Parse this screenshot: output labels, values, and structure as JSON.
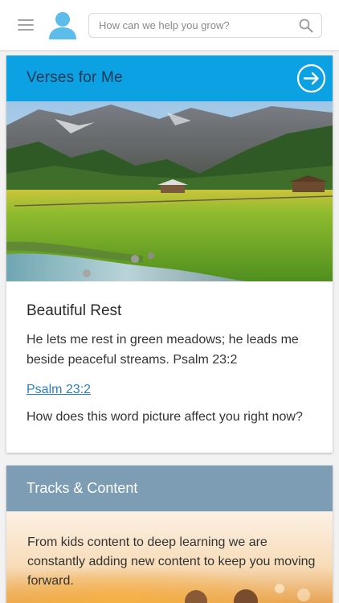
{
  "header": {
    "search_placeholder": "How can we help you grow?",
    "icons": [
      "menu-icon",
      "avatar-icon",
      "search-icon"
    ]
  },
  "verses_card": {
    "title": "Verses for Me",
    "header_color": "#0ba1e2",
    "verse_title": "Beautiful Rest",
    "verse_text": "He lets me rest in green meadows; he leads me beside peaceful streams. Psalm 23:2",
    "link_text": "Psalm 23:2",
    "question": "How does this word picture affect you right now?"
  },
  "tracks_card": {
    "title": "Tracks & Content",
    "header_color": "#7c9db3",
    "description": "From kids content to deep learning we are constantly adding new content to keep you moving forward."
  }
}
